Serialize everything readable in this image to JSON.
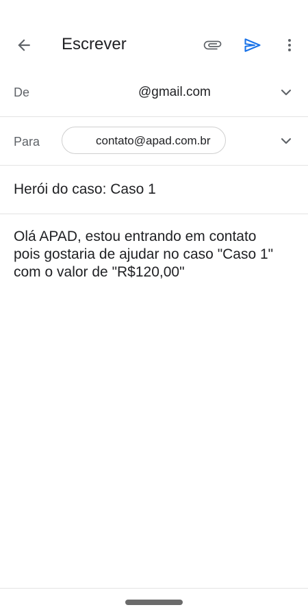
{
  "appbar": {
    "title": "Escrever",
    "icons": {
      "back": "arrow-back-icon",
      "attach": "paperclip-icon",
      "send": "send-icon",
      "more": "more-vert-icon"
    },
    "send_color": "#1a73e8"
  },
  "from": {
    "label": "De",
    "value": "@gmail.com"
  },
  "to": {
    "label": "Para",
    "recipient": "contato@apad.com.br"
  },
  "subject": "Herói do caso: Caso 1",
  "body": "Olá APAD, estou  entrando em contato\npois gostaria  de ajudar no caso \"Caso 1\"\ncom o valor de \"R$120,00\""
}
